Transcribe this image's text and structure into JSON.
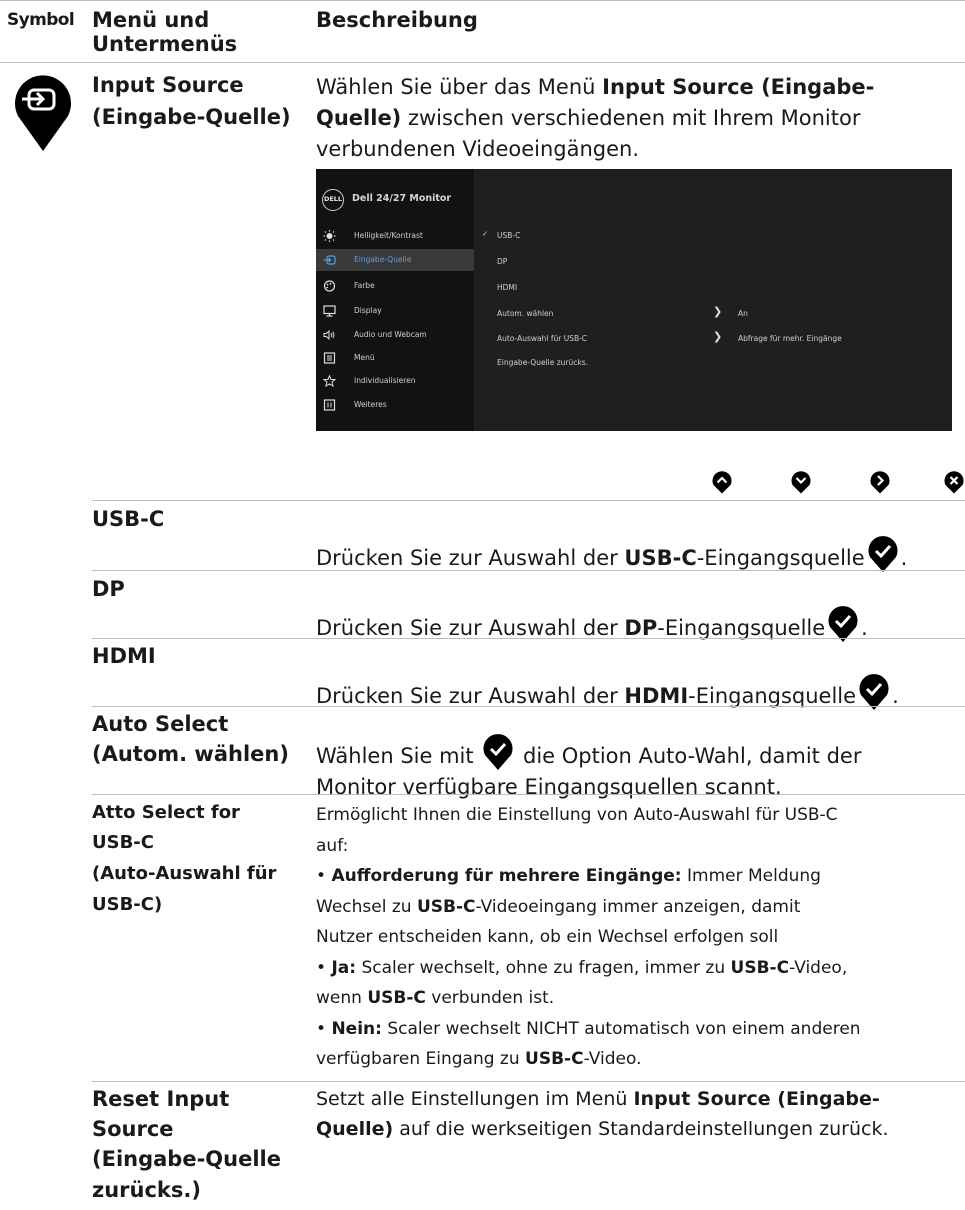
{
  "headers": {
    "symbol": "Symbol",
    "menu_line1": "Menü und",
    "menu_line2": "Untermenüs",
    "description": "Beschreibung"
  },
  "input_source": {
    "label_line1": "Input Source",
    "label_line2": "(Eingabe-Quelle)",
    "desc_p1": "Wählen Sie über das Menü ",
    "desc_b1": "Input Source (Eingabe-",
    "desc_b2": "Quelle)",
    "desc_p2": " zwischen verschiedenen mit Ihrem Monitor",
    "desc_p3": "verbundenen Videoeingängen."
  },
  "osd": {
    "logo": "DELL",
    "title": "Dell 24/27 Monitor",
    "menu": [
      {
        "label": "Helligkeit/Kontrast",
        "icon": "brightness-icon"
      },
      {
        "label": "Eingabe-Quelle",
        "icon": "input-icon",
        "active": true
      },
      {
        "label": "Farbe",
        "icon": "palette-icon"
      },
      {
        "label": "Display",
        "icon": "display-icon"
      },
      {
        "label": "Audio und Webcam",
        "icon": "speaker-icon"
      },
      {
        "label": "Menü",
        "icon": "menu-icon"
      },
      {
        "label": "Individualisieren",
        "icon": "star-icon"
      },
      {
        "label": "Weiteres",
        "icon": "info-icon"
      }
    ],
    "options": [
      {
        "label": "USB-C",
        "checked": true
      },
      {
        "label": "DP"
      },
      {
        "label": "HDMI"
      },
      {
        "label": "Autom. wählen",
        "value": "An"
      },
      {
        "label": "Auto-Auswahl für USB-C",
        "value": "Abfrage für mehr. Eingänge"
      },
      {
        "label": "Eingabe-Quelle zurücks."
      }
    ],
    "nav_buttons": [
      "up-icon",
      "down-icon",
      "right-icon",
      "close-icon"
    ]
  },
  "rows": {
    "usbc": {
      "label": "USB-C",
      "pre": "Drücken Sie zur Auswahl der ",
      "bold": "USB-C",
      "post": "-Eingangsquelle",
      "end": "."
    },
    "dp": {
      "label": "DP",
      "pre": "Drücken Sie zur Auswahl der ",
      "bold": "DP",
      "post": "-Eingangsquelle",
      "end": "."
    },
    "hdmi": {
      "label": "HDMI",
      "pre": "Drücken Sie zur Auswahl der ",
      "bold": "HDMI",
      "post": "-Eingangsquelle",
      "end": "."
    },
    "auto": {
      "label_line1": "Auto Select",
      "label_line2": "(Autom. wählen)",
      "pre": "Wählen Sie mit ",
      "post": " die Option Auto-Wahl, damit der",
      "line2": "Monitor verfügbare Eingangsquellen scannt."
    },
    "auto_usbc": {
      "label_lines": [
        "Atto Select for",
        "USB-C",
        "(Auto-Auswahl für",
        "USB-C)"
      ],
      "l1": "Ermöglicht Ihnen die Einstellung von Auto-Auswahl für USB-C",
      "l2": "auf:",
      "b1_bold": "Aufforderung für mehrere Eingänge:",
      "b1_rest": " Immer Meldung",
      "b1_l2_pre": "Wechsel zu ",
      "b1_l2_bold": "USB-C",
      "b1_l2_post": "-Videoeingang immer anzeigen, damit",
      "b1_l3": "Nutzer entscheiden kann, ob ein Wechsel erfolgen soll",
      "b2_bold": "Ja:",
      "b2_pre": " Scaler wechselt, ohne zu fragen, immer zu ",
      "b2_b": "USB-C",
      "b2_post": "-Video,",
      "b2_l2_pre": "wenn ",
      "b2_l2_b": "USB-C",
      "b2_l2_post": " verbunden ist.",
      "b3_bold": "Nein:",
      "b3_rest": " Scaler wechselt NICHT automatisch von einem anderen",
      "b3_l2_pre": "verfügbaren Eingang zu ",
      "b3_l2_b": "USB-C",
      "b3_l2_post": "-Video.",
      "bullet": "•"
    },
    "reset": {
      "label_lines": [
        "Reset Input",
        "Source",
        "(Eingabe-Quelle",
        "zurücks.)"
      ],
      "l1_pre": "Setzt alle Einstellungen im Menü ",
      "l1_b": "Input Source (Eingabe-",
      "l2_b": "Quelle)",
      "l2_post": " auf die werkseitigen Standardeinstellungen zurück."
    }
  }
}
